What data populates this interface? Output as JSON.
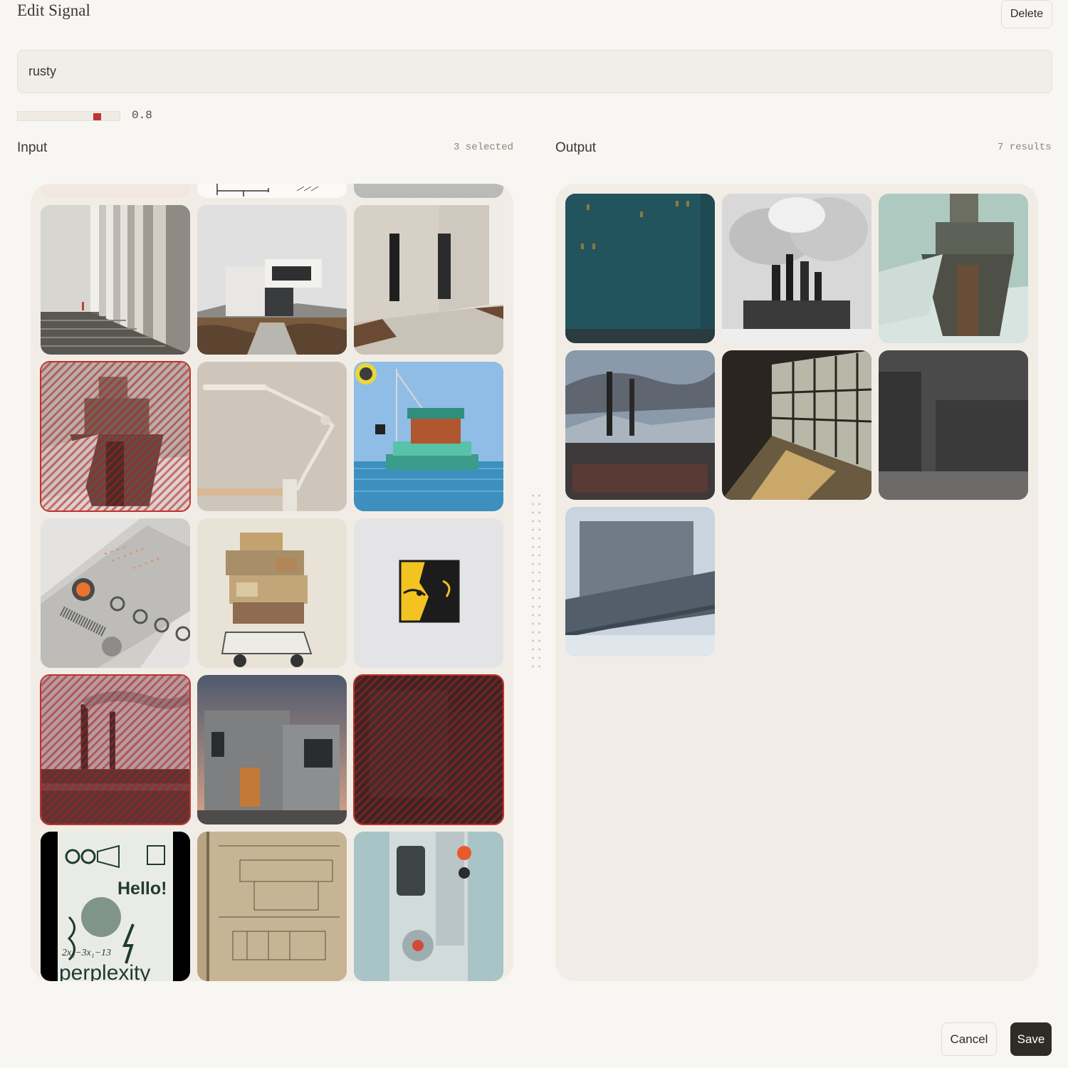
{
  "header": {
    "title": "Edit Signal",
    "delete_label": "Delete"
  },
  "signal": {
    "query": "rusty",
    "weight": "0.8",
    "weight_fraction": 0.8
  },
  "input": {
    "title": "Input",
    "selected_text": "3 selected",
    "images": [
      {
        "name": "peeking-tile-sketch"
      },
      {
        "name": "peeking-tile-grey"
      },
      {
        "name": "corridor-columns"
      },
      {
        "name": "concrete-house-desert"
      },
      {
        "name": "white-house-facade"
      },
      {
        "name": "rusty-tower-ship",
        "selected": true
      },
      {
        "name": "desk-lamp"
      },
      {
        "name": "voxel-boat-island"
      },
      {
        "name": "synth-device"
      },
      {
        "name": "boxes-on-car"
      },
      {
        "name": "yellow-face-logo"
      },
      {
        "name": "smokestacks-city",
        "selected": true
      },
      {
        "name": "concrete-house-dusk"
      },
      {
        "name": "dark-building-fog",
        "selected": true
      },
      {
        "name": "perplexity-poster",
        "text_top": "Hello!",
        "text_bottom": "perplexity",
        "formula": "2x₂−3x₁−13"
      },
      {
        "name": "notebook-schematic"
      },
      {
        "name": "sony-walkman"
      }
    ]
  },
  "output": {
    "title": "Output",
    "results_text": "7 results",
    "images": [
      {
        "name": "teal-apartment-block"
      },
      {
        "name": "refinery-smoke"
      },
      {
        "name": "frozen-ship-tower"
      },
      {
        "name": "smokestacks-dusk"
      },
      {
        "name": "abandoned-factory-hall"
      },
      {
        "name": "foggy-apartments"
      },
      {
        "name": "snowy-industrial-ruin"
      }
    ]
  },
  "footer": {
    "cancel_label": "Cancel",
    "save_label": "Save"
  },
  "colors": {
    "accent": "#c0332e",
    "background": "#f8f6f2",
    "panel": "#f1ede6",
    "save_button": "#2f2c26"
  }
}
